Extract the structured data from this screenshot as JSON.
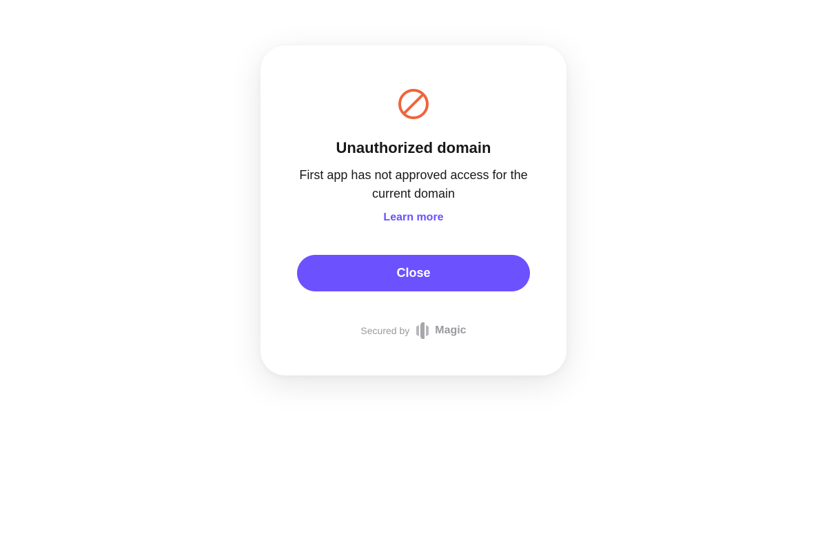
{
  "colors": {
    "accent": "#6c51ff",
    "link": "#6851ff",
    "error": "#f0643c",
    "muted": "#9a9a9f",
    "text": "#18171a"
  },
  "modal": {
    "icon": "prohibited-icon",
    "title": "Unauthorized domain",
    "message": "First app has not approved access for the current domain",
    "learn_more_label": "Learn more",
    "close_label": "Close"
  },
  "footer": {
    "secured_label": "Secured by",
    "brand_icon": "magic-logo-icon",
    "brand_name": "Magic"
  }
}
